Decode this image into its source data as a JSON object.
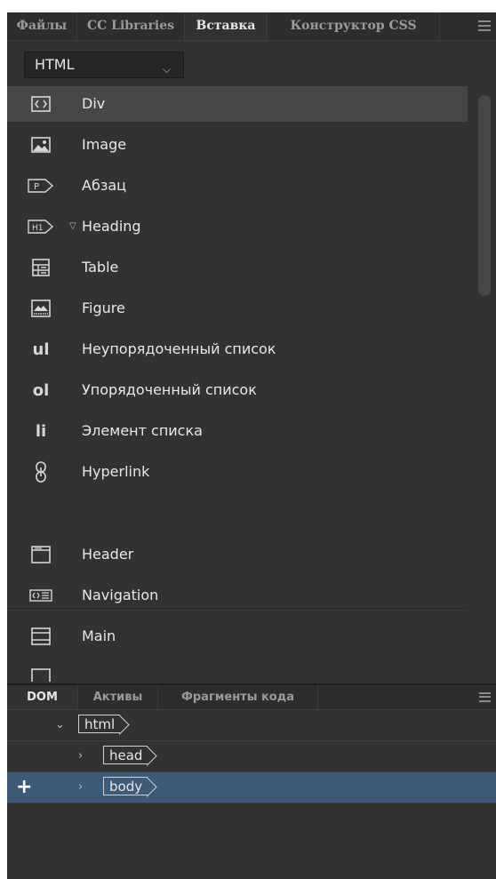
{
  "insert_panel": {
    "tabs": [
      "Файлы",
      "CC Libraries",
      "Вставка",
      "Конструктор CSS"
    ],
    "active_tab": "Вставка",
    "category": "HTML",
    "items": [
      {
        "label": "Div",
        "icon": "div-icon"
      },
      {
        "label": "Image",
        "icon": "image-icon"
      },
      {
        "label": "Абзац",
        "icon": "paragraph-icon"
      },
      {
        "label": "Heading",
        "icon": "heading-icon"
      },
      {
        "label": "Table",
        "icon": "table-icon"
      },
      {
        "label": "Figure",
        "icon": "figure-icon"
      },
      {
        "label": "Неупорядоченный список",
        "icon": "ul-icon",
        "glyph": "ul"
      },
      {
        "label": "Упорядоченный список",
        "icon": "ol-icon",
        "glyph": "ol"
      },
      {
        "label": "Элемент списка",
        "icon": "li-icon",
        "glyph": "li"
      },
      {
        "label": "Hyperlink",
        "icon": "hyperlink-icon"
      },
      {
        "label": "Header",
        "icon": "header-icon"
      },
      {
        "label": "Navigation",
        "icon": "navigation-icon"
      },
      {
        "label": "Main",
        "icon": "main-icon"
      }
    ],
    "selected_item": "Div"
  },
  "dom_panel": {
    "tabs": [
      "DOM",
      "Активы",
      "Фрагменты кода"
    ],
    "active_tab": "DOM",
    "tree": [
      {
        "tag": "html",
        "expander": "⌄"
      },
      {
        "tag": "head",
        "expander": "›"
      },
      {
        "tag": "body",
        "expander": "›"
      }
    ],
    "add_button": "+"
  },
  "colors": {
    "panel_bg": "#323232",
    "selected_item_bg": "#474747",
    "selected_dom_row_bg": "#3d5a78"
  }
}
